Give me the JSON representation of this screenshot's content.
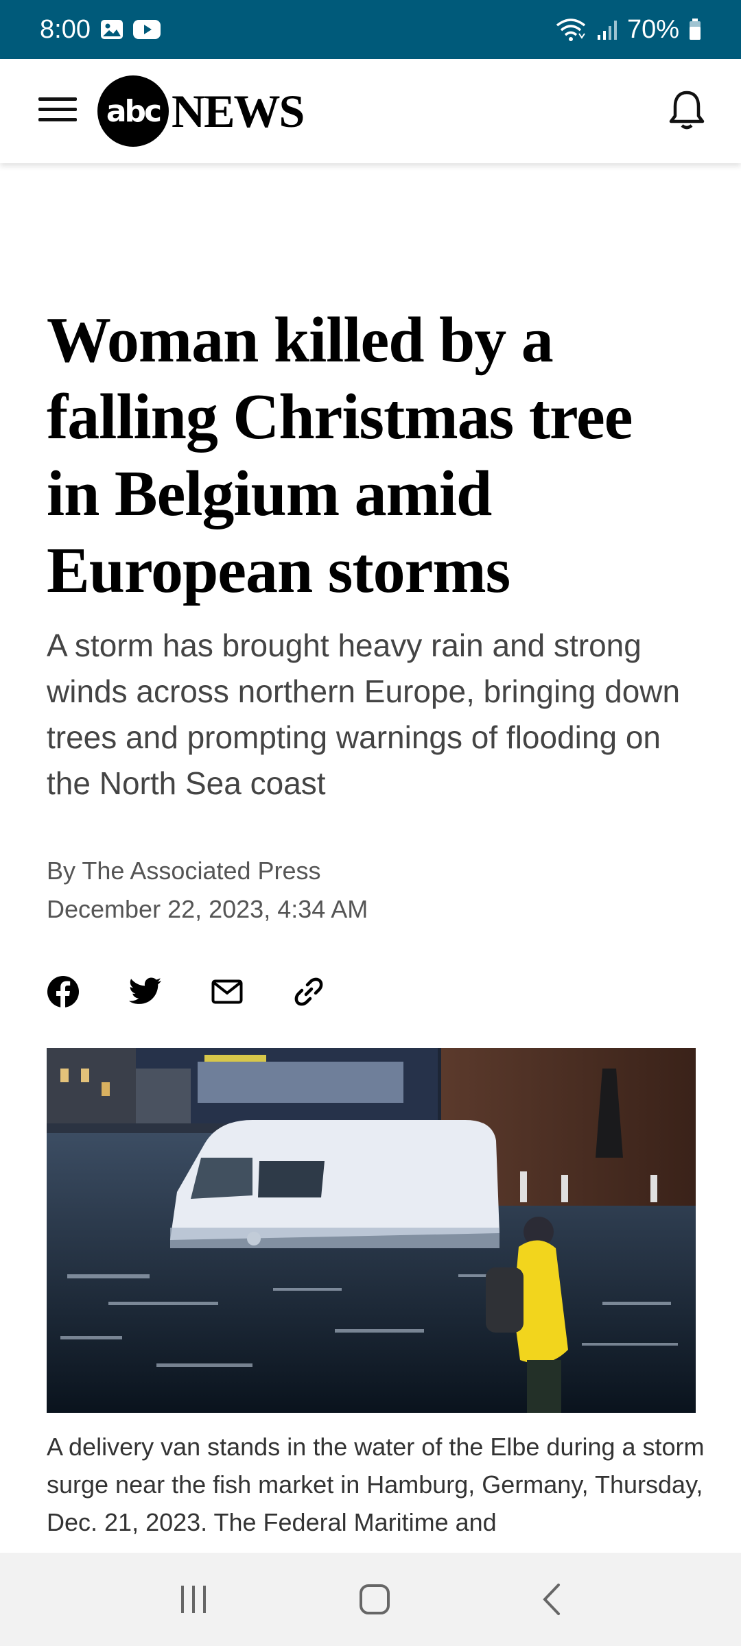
{
  "status_bar": {
    "time": "8:00",
    "battery": "70%",
    "icons": [
      "gallery-icon",
      "youtube-icon",
      "wifi-icon",
      "signal-icon",
      "battery-icon"
    ]
  },
  "header": {
    "logo_abc": "abc",
    "logo_news": "NEWS",
    "icons": [
      "menu-icon",
      "bell-icon"
    ]
  },
  "article": {
    "headline": "Woman killed by a falling Christmas tree in Belgium amid European storms",
    "dek": "A storm has brought heavy rain and strong winds across northern Europe, bringing down trees and prompting warnings of flooding on the North Sea coast",
    "author": "By The Associated Press",
    "date": "December 22, 2023, 4:34 AM",
    "share_icons": [
      "facebook-icon",
      "twitter-icon",
      "email-icon",
      "link-icon"
    ],
    "caption": "A delivery van stands in the water of the Elbe during a storm surge near the fish market in Hamburg, Germany, Thursday, Dec. 21, 2023. The Federal Maritime and"
  },
  "nav_bar": {
    "icons": [
      "recent-apps-icon",
      "home-icon",
      "back-icon"
    ]
  },
  "colors": {
    "status_bar_bg": "#005a7a",
    "nav_bar_bg": "#f2f2f2",
    "headline": "#000000",
    "dek": "#444444"
  }
}
